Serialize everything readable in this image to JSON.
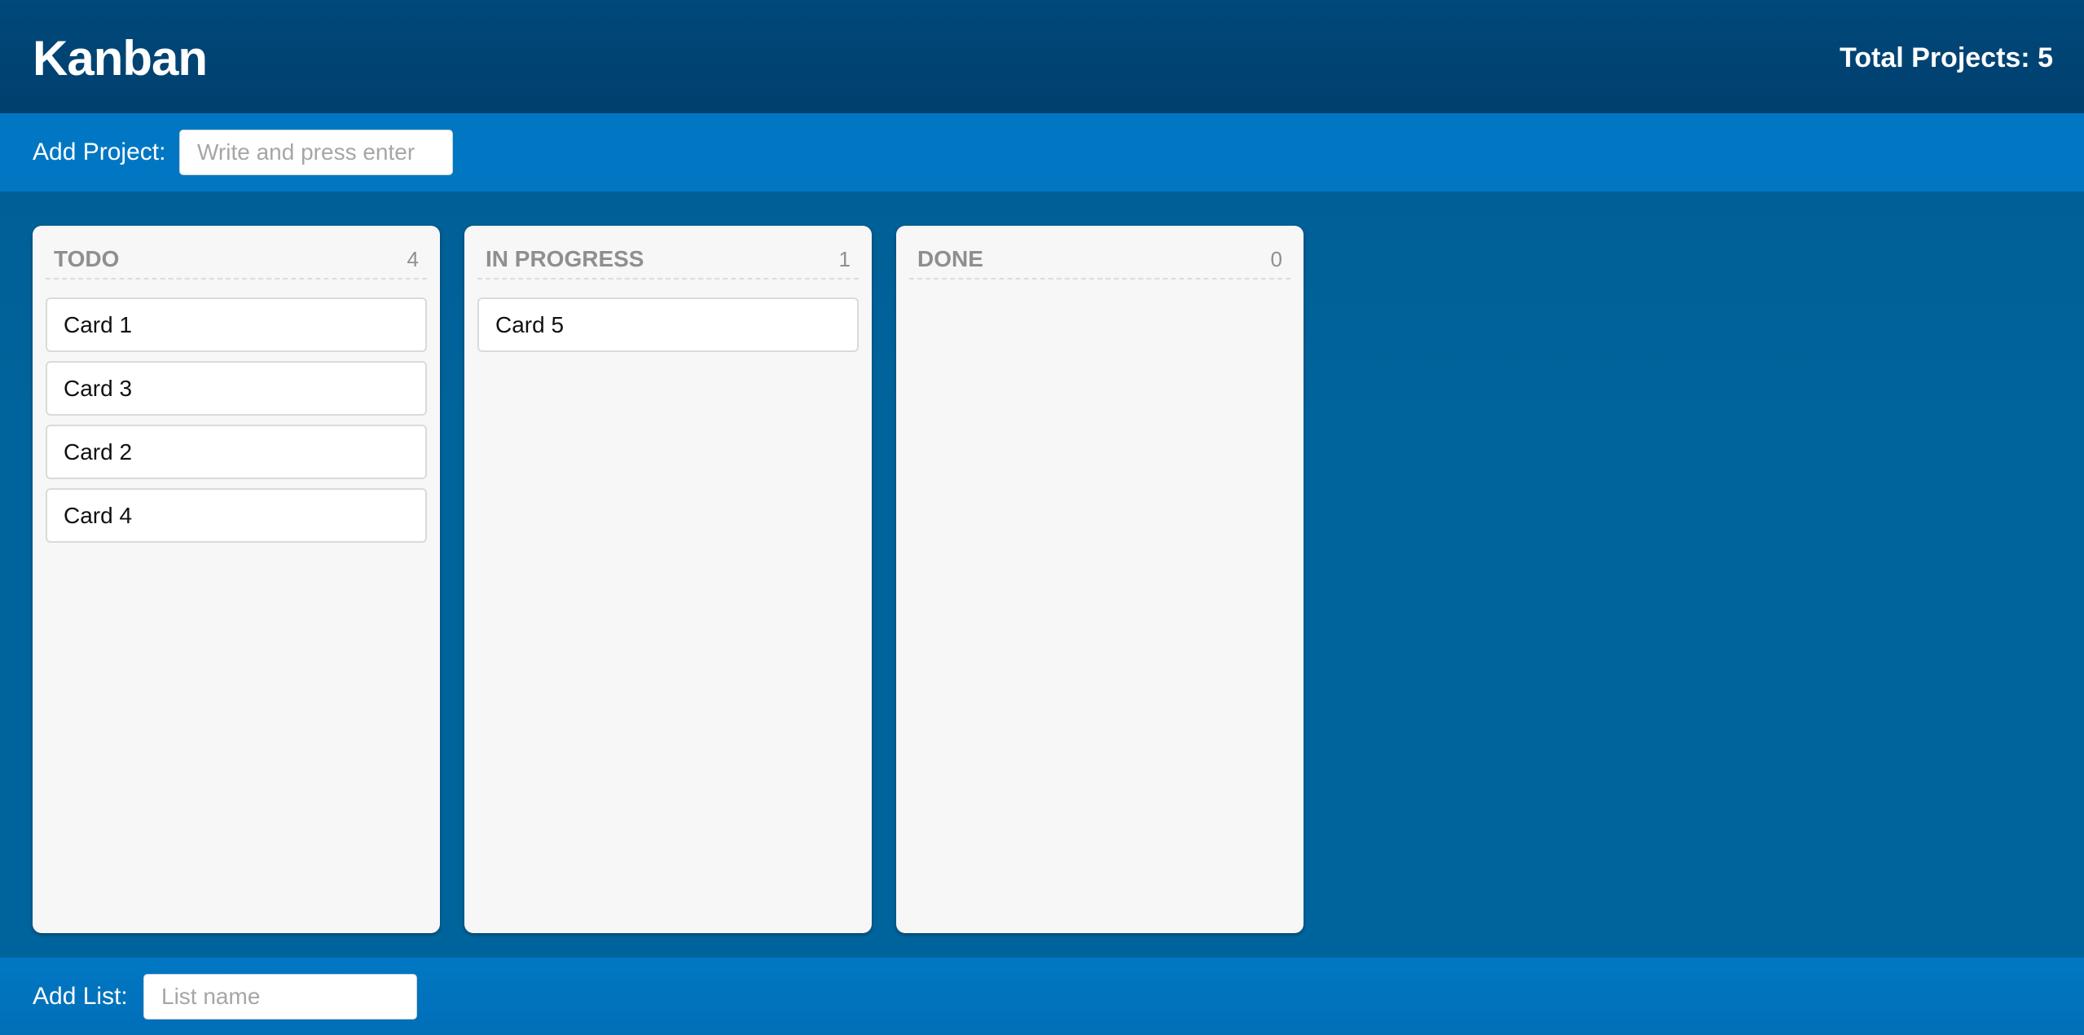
{
  "header": {
    "title": "Kanban",
    "total_projects": "Total Projects: 5"
  },
  "add_project": {
    "label": "Add Project:",
    "placeholder": "Write and press enter",
    "value": ""
  },
  "lists": [
    {
      "title": "TODO",
      "count": "4",
      "cards": [
        "Card 1",
        "Card 3",
        "Card 2",
        "Card 4"
      ]
    },
    {
      "title": "IN PROGRESS",
      "count": "1",
      "cards": [
        "Card 5"
      ]
    },
    {
      "title": "DONE",
      "count": "0",
      "cards": []
    }
  ],
  "add_list": {
    "label": "Add List:",
    "placeholder": "List name",
    "value": ""
  },
  "colors": {
    "header_bg": "#00497a",
    "toolbar_bg": "#0177c3",
    "board_bg": "#00649c",
    "list_bg": "#f7f7f7",
    "list_title": "#8f8f8f"
  }
}
